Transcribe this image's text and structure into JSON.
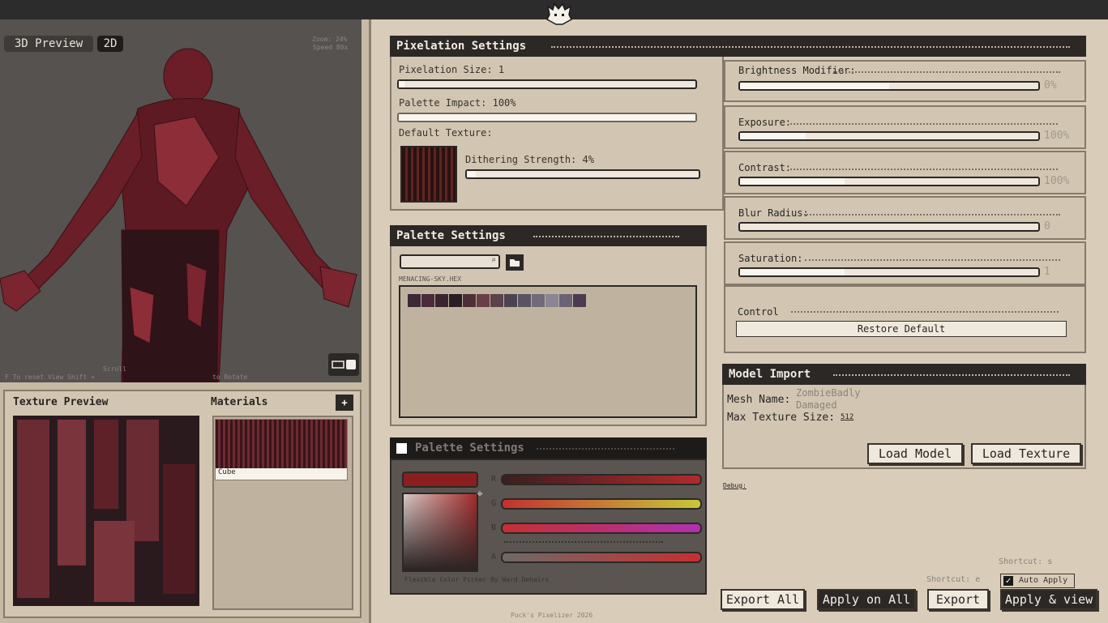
{
  "viewport": {
    "btn_3d": "3D Preview",
    "btn_2d": "2D",
    "zoom": "Zoom: 24%",
    "speed": "Speed 80x",
    "hint_scroll": "Scroll",
    "hint_reset": "F To reset View  Shift +",
    "hint_rotate": "to Rotate"
  },
  "texture_preview": {
    "title": "Texture Preview"
  },
  "materials": {
    "title": "Materials",
    "add_label": "+",
    "items": [
      "Cube"
    ]
  },
  "pixelation": {
    "title": "Pixelation Settings",
    "size_label": "Pixelation Size: 1",
    "palette_impact_label": "Palette Impact: 100%",
    "default_texture_label": "Default Texture:",
    "dithering_label": "Dithering Strength: 4%",
    "size_value": 0.02,
    "palette_impact_value": 1.0,
    "dithering_value": 0.04
  },
  "adjust": [
    {
      "label": "Brightness Modifier:",
      "value": "0%",
      "fill": 0.5
    },
    {
      "label": "Exposure:",
      "value": "100%",
      "fill": 0.22
    },
    {
      "label": "Contrast:",
      "value": "100%",
      "fill": 0.35
    },
    {
      "label": "Blur Radius:",
      "value": "0",
      "fill": 0.0
    },
    {
      "label": "Saturation:",
      "value": "1",
      "fill": 0.35
    }
  ],
  "control": {
    "label": "Control",
    "restore": "Restore Default"
  },
  "palette": {
    "title": "Palette Settings",
    "filename": "MENACING-SKY.HEX",
    "colors": [
      "#3e2837",
      "#4b2a3b",
      "#3a2431",
      "#2a1d26",
      "#4d3037",
      "#6a3e47",
      "#5b4149",
      "#4c4350",
      "#595462",
      "#706a7a",
      "#8a8595",
      "#6b6276",
      "#4a3a52"
    ]
  },
  "color_picker": {
    "title": "Palette Settings",
    "r": "R",
    "g": "G",
    "b": "B",
    "a": "A",
    "credit": "Flexible Color Picker By Ward Dehairs"
  },
  "model_import": {
    "title": "Model Import",
    "mesh_label": "Mesh Name:",
    "mesh_value": "ZombieBadly\nDamaged",
    "max_tex_label": "Max Texture Size:",
    "max_tex_value": "512",
    "load_model": "Load Model",
    "load_texture": "Load Texture"
  },
  "debug": "Debug:",
  "footer": {
    "shortcut_s": "Shortcut: s",
    "shortcut_e": "Shortcut: e",
    "auto_apply": "Auto Apply",
    "export_all": "Export All",
    "apply_all": "Apply on All",
    "export": "Export",
    "apply_view": "Apply & view",
    "credit": "Puck's Pixelizer 2026"
  }
}
